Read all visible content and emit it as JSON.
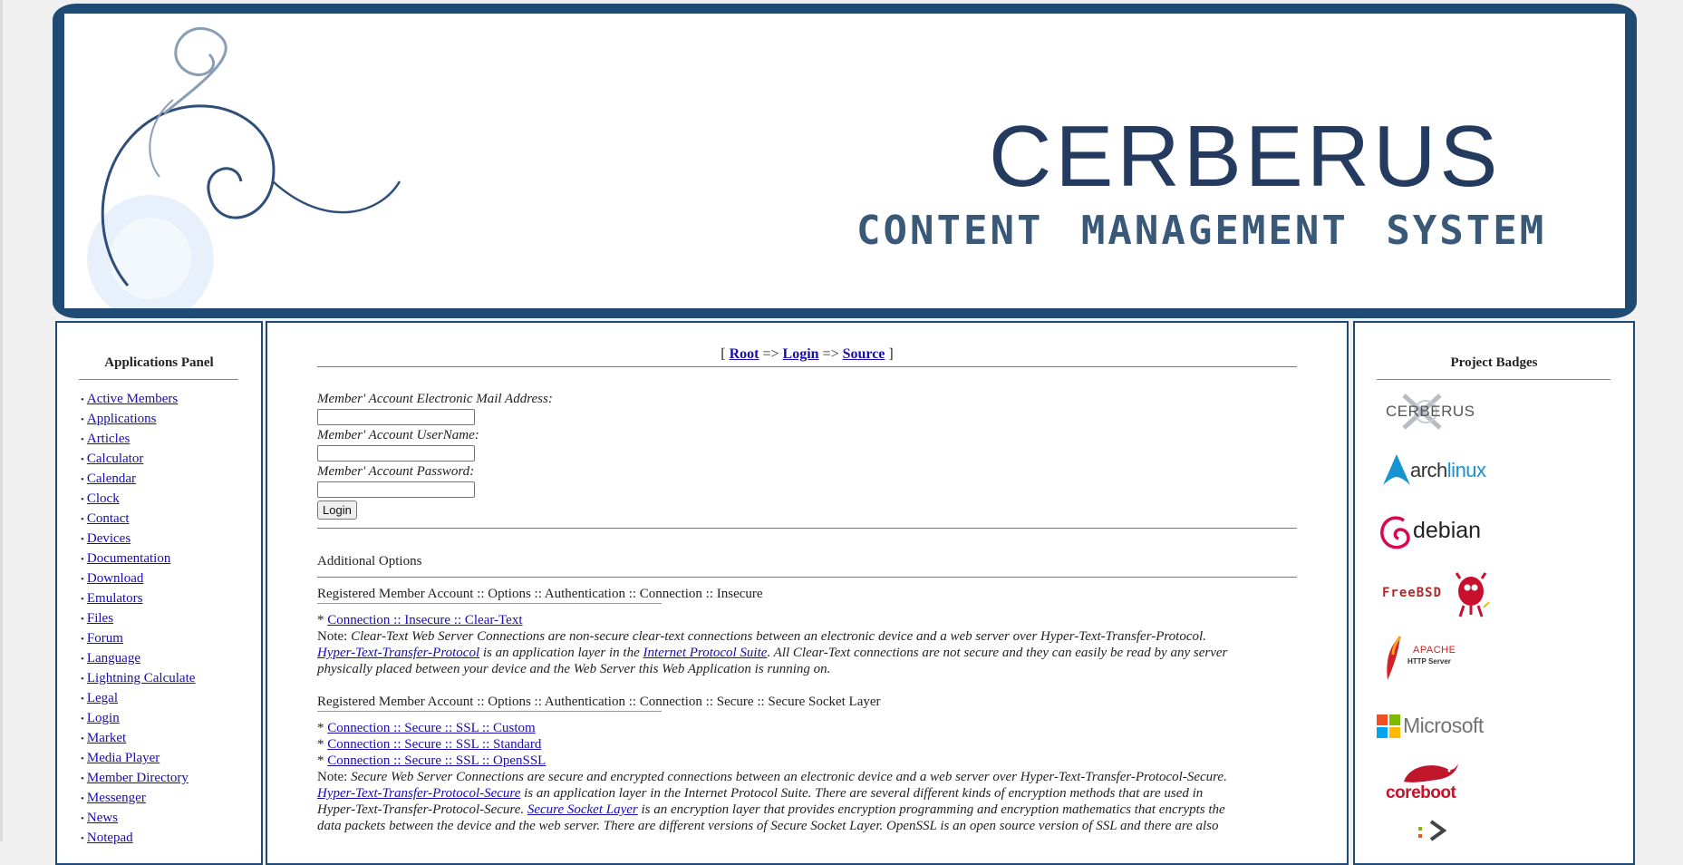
{
  "banner": {
    "title": "CERBERUS",
    "subtitle": "CONTENT MANAGEMENT SYSTEM"
  },
  "left_panel": {
    "heading": "Applications Panel",
    "items": [
      "Active Members",
      "Applications",
      "Articles",
      "Calculator",
      "Calendar",
      "Clock",
      "Contact",
      "Devices",
      "Documentation",
      "Download",
      "Emulators",
      "Files",
      "Forum",
      "Language",
      "Lightning Calculate",
      "Legal",
      "Login",
      "Market",
      "Media Player",
      "Member Directory",
      "Messenger",
      "News",
      "Notepad"
    ]
  },
  "breadcrumb": {
    "open": "[",
    "root": "Root",
    "sep1": "=>",
    "login": "Login",
    "sep2": "=>",
    "source": "Source",
    "close": "]"
  },
  "login_form": {
    "email_label": "Member' Account Electronic Mail Address",
    "username_label": "Member' Account UserName",
    "password_label": "Member' Account Password",
    "email_value": "",
    "username_value": "",
    "password_value": "",
    "login_button": "Login"
  },
  "options": {
    "title": "Additional Options",
    "insecure": {
      "heading": "Registered Member Account :: Options :: Authentication :: Connection :: Insecure",
      "links": [
        "Connection :: Insecure :: Clear-Text"
      ],
      "note_prefix": "Note: ",
      "note_1": "Clear-Text Web Server Connections are non-secure clear-text connections between an electronic device and a web server over Hyper-Text-Transfer-Protocol.",
      "link_http": "Hyper-Text-Transfer-Protocol",
      "note_2": " is an application layer in the ",
      "link_ips": "Internet Protocol Suite",
      "note_3": ". All Clear-Text connections are not secure and they can easily be read by any server",
      "note_4": "physically placed between your device and the Web Server this Web Application is running on."
    },
    "secure": {
      "heading": "Registered Member Account :: Options :: Authentication :: Connection :: Secure :: Secure Socket Layer",
      "links": [
        "Connection :: Secure :: SSL :: Custom",
        "Connection :: Secure :: SSL :: Standard",
        "Connection :: Secure :: SSL :: OpenSSL"
      ],
      "note_prefix": "Note: ",
      "note_1": "Secure Web Server Connections are secure and encrypted connections between an electronic device and a web server over Hyper-Text-Transfer-Protocol-Secure.",
      "link_https": "Hyper-Text-Transfer-Protocol-Secure",
      "note_2": " is an application layer in the Internet Protocol Suite. There are several different kinds of encryption methods that are used in",
      "note_3": "Hyper-Text-Transfer-Protocol-Secure. ",
      "link_ssl": "Secure Socket Layer",
      "note_4": " is an encryption layer that provides encryption programming and encryption mathematics that encrypts the",
      "note_5": "data packets between the device and the web server. There are different versions of Secure Socket Layer. OpenSSL is an open source version of SSL and there are also"
    }
  },
  "right_panel": {
    "heading": "Project Badges",
    "badges": [
      {
        "name": "cerberus",
        "text": "CERBERUS"
      },
      {
        "name": "archlinux",
        "text_a": "arch",
        "text_b": "linux"
      },
      {
        "name": "debian",
        "text": "debian"
      },
      {
        "name": "freebsd",
        "text": "FreeBSD"
      },
      {
        "name": "apache",
        "text_a": "APACHE",
        "text_b": "HTTP Server"
      },
      {
        "name": "microsoft",
        "text": "Microsoft"
      },
      {
        "name": "coreboot",
        "text": "coreboot"
      }
    ]
  },
  "colors": {
    "banner_frame": "#1e4a73",
    "link": "#1a0dab",
    "title": "#243a5e"
  }
}
